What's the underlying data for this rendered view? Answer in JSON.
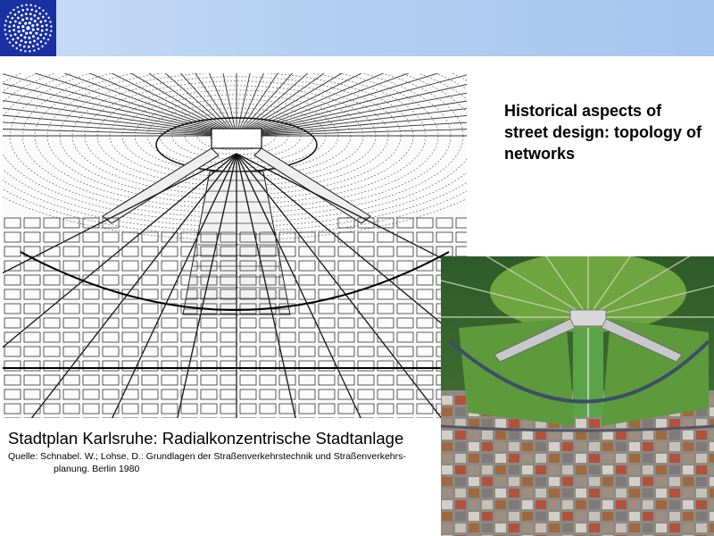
{
  "slide": {
    "heading": "Historical aspects of street design: topology of networks",
    "caption_title": "Stadtplan Karlsruhe: Radialkonzentrische Stadtanlage",
    "caption_source_line1": "Quelle: Schnabel. W.; Lohse, D.: Grundlagen der Straßenverkehrstechnik und Straßenverkehrs-",
    "caption_source_line2": "planung. Berlin 1980"
  },
  "colors": {
    "header_bar": "#b4cff2",
    "logo_background": "#1a2fa0",
    "logo_stars": "#ffffff"
  },
  "images": {
    "logo": "star-circle-logo",
    "left": "karlsruhe-engraving-radial-plan",
    "right": "karlsruhe-aerial-photo"
  }
}
